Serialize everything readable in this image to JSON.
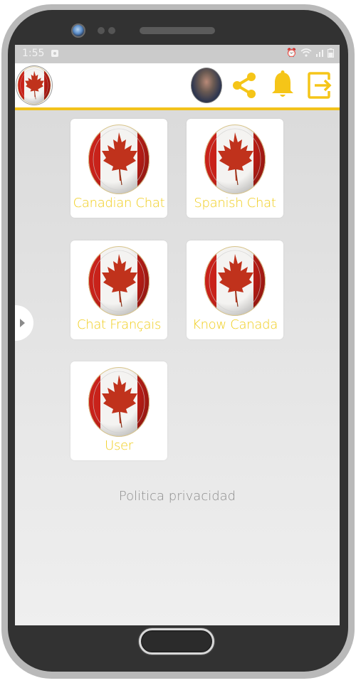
{
  "status_bar": {
    "time": "1:55",
    "icons": [
      "image-notification-icon",
      "alarm-icon",
      "wifi-icon",
      "signal-icon",
      "battery-icon"
    ]
  },
  "app_bar": {
    "logo": "canada-flag-logo",
    "actions": [
      {
        "name": "profile-avatar",
        "label": "Profile"
      },
      {
        "name": "share-icon",
        "label": "Share"
      },
      {
        "name": "bell-icon",
        "label": "Notifications"
      },
      {
        "name": "logout-icon",
        "label": "Exit"
      }
    ],
    "accent_color": "#f2c21b"
  },
  "tiles": [
    {
      "label": "Canadian Chat",
      "icon": "canada-flag-icon"
    },
    {
      "label": "Spanish Chat",
      "icon": "canada-flag-icon"
    },
    {
      "label": "Chat Français",
      "icon": "canada-flag-icon"
    },
    {
      "label": "Know Canada",
      "icon": "canada-flag-icon"
    },
    {
      "label": "User",
      "icon": "canada-flag-icon"
    }
  ],
  "footer": {
    "privacy_link": "Politica privacidad"
  },
  "colors": {
    "label_yellow": "#f0cd1a",
    "icon_yellow": "#f5c518",
    "flag_red": "#c8221a"
  }
}
